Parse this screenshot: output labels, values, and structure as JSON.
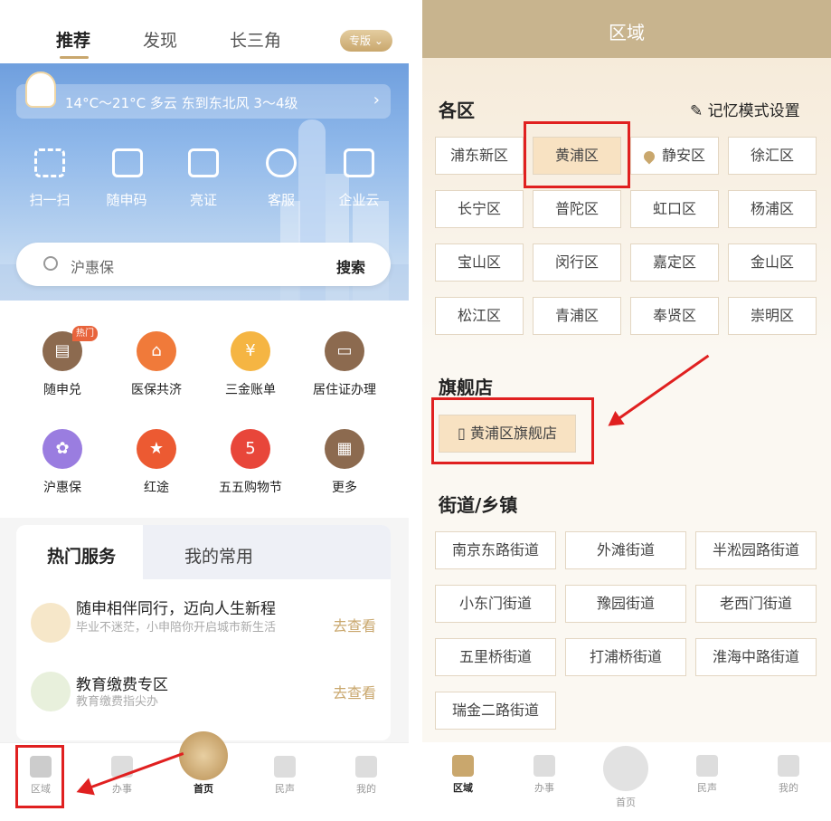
{
  "left": {
    "tabs": [
      "推荐",
      "发现",
      "长三角"
    ],
    "special_edition": "专版",
    "weather": "14°C～21°C 多云 东到东北风 3～4级",
    "quick_actions": [
      "扫一扫",
      "随申码",
      "亮证",
      "客服",
      "企业云"
    ],
    "search": {
      "placeholder": "沪惠保",
      "button": "搜索"
    },
    "hot_badge": "热门",
    "services_row1": [
      "随申兑",
      "医保共济",
      "三金账单",
      "居住证办理"
    ],
    "services_row2": [
      "沪惠保",
      "红途",
      "五五购物节",
      "更多"
    ],
    "hot_tabs": [
      "热门服务",
      "我的常用"
    ],
    "items": [
      {
        "title": "随申相伴同行，迈向人生新程",
        "desc": "毕业不迷茫，小申陪你开启城市新生活",
        "action": "去查看"
      },
      {
        "title": "教育缴费专区",
        "desc": "教育缴费指尖办",
        "action": "去查看"
      }
    ],
    "nav": [
      "区域",
      "办事",
      "首页",
      "民声",
      "我的"
    ]
  },
  "right": {
    "header": "区域",
    "districts_title": "各区",
    "memory_mode": "记忆模式设置",
    "districts": [
      "浦东新区",
      "黄浦区",
      "静安区",
      "徐汇区",
      "长宁区",
      "普陀区",
      "虹口区",
      "杨浦区",
      "宝山区",
      "闵行区",
      "嘉定区",
      "金山区",
      "松江区",
      "青浦区",
      "奉贤区",
      "崇明区"
    ],
    "flagship_title": "旗舰店",
    "flagship_store": "黄浦区旗舰店",
    "streets_title": "街道/乡镇",
    "streets": [
      "南京东路街道",
      "外滩街道",
      "半淞园路街道",
      "小东门街道",
      "豫园街道",
      "老西门街道",
      "五里桥街道",
      "打浦桥街道",
      "淮海中路街道",
      "瑞金二路街道"
    ],
    "nav": [
      "区域",
      "办事",
      "首页",
      "民声",
      "我的"
    ]
  },
  "colors": {
    "accent": "#c9a76d",
    "highlight_red": "#e02020",
    "selected_bg": "#f8e2c2"
  }
}
